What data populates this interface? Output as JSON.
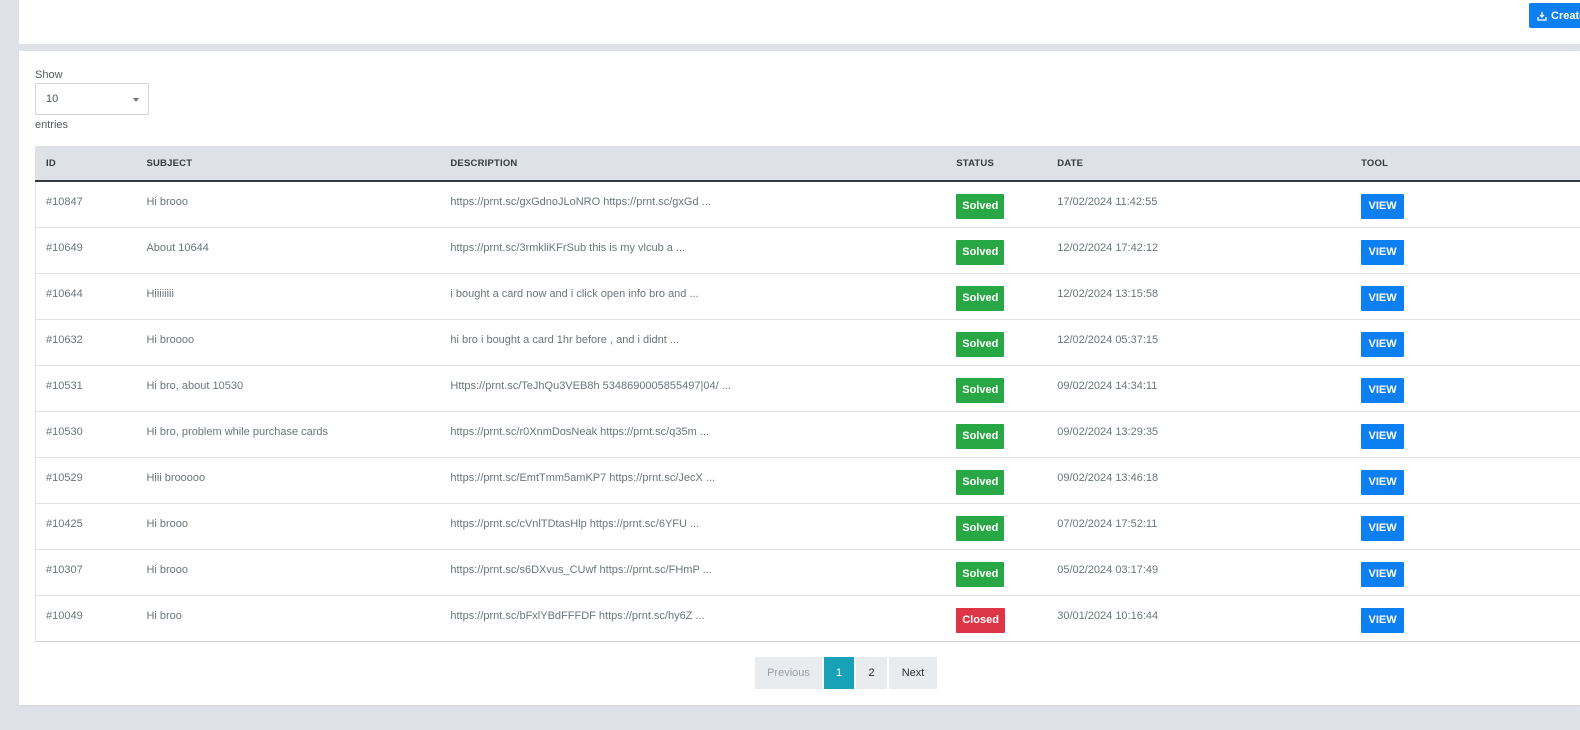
{
  "toolbar": {
    "create_label": "Create"
  },
  "length_menu": {
    "show_label": "Show",
    "value": "10",
    "entries_label": "entries"
  },
  "table": {
    "headers": [
      "ID",
      "SUBJECT",
      "DESCRIPTION",
      "STATUS",
      "DATE",
      "TOOL"
    ],
    "rows": [
      {
        "id": "#10847",
        "subject": "Hi brooo",
        "description": "https://prnt.sc/gxGdnoJLoNRO https://prnt.sc/gxGd ...",
        "status": "Solved",
        "date": "17/02/2024 11:42:55",
        "tool": "VIEW"
      },
      {
        "id": "#10649",
        "subject": "About 10644",
        "description": "https://prnt.sc/3rmkliKFrSub this is my vlcub a ...",
        "status": "Solved",
        "date": "12/02/2024 17:42:12",
        "tool": "VIEW"
      },
      {
        "id": "#10644",
        "subject": "Hiiiiiiii",
        "description": "i bought a card now and i click open info bro and ...",
        "status": "Solved",
        "date": "12/02/2024 13:15:58",
        "tool": "VIEW"
      },
      {
        "id": "#10632",
        "subject": "Hi broooo",
        "description": "hi bro i bought a card 1hr before , and i didnt ...",
        "status": "Solved",
        "date": "12/02/2024 05:37:15",
        "tool": "VIEW"
      },
      {
        "id": "#10531",
        "subject": "Hi bro, about 10530",
        "description": "Https://prnt.sc/TeJhQu3VEB8h 5348690005855497|04/ ...",
        "status": "Solved",
        "date": "09/02/2024 14:34:11",
        "tool": "VIEW"
      },
      {
        "id": "#10530",
        "subject": "Hi bro, problem while purchase cards",
        "description": "https://prnt.sc/r0XnmDosNeak https://prnt.sc/q35m ...",
        "status": "Solved",
        "date": "09/02/2024 13:29:35",
        "tool": "VIEW"
      },
      {
        "id": "#10529",
        "subject": "Hiii brooooo",
        "description": "https://prnt.sc/EmtTmm5amKP7 https://prnt.sc/JecX ...",
        "status": "Solved",
        "date": "09/02/2024 13:46:18",
        "tool": "VIEW"
      },
      {
        "id": "#10425",
        "subject": "Hi brooo",
        "description": "https://prnt.sc/cVnlTDtasHlp https://prnt.sc/6YFU ...",
        "status": "Solved",
        "date": "07/02/2024 17:52:11",
        "tool": "VIEW"
      },
      {
        "id": "#10307",
        "subject": "Hi brooo",
        "description": "https://prnt.sc/s6DXvus_CUwf https://prnt.sc/FHmP ...",
        "status": "Solved",
        "date": "05/02/2024 03:17:49",
        "tool": "VIEW"
      },
      {
        "id": "#10049",
        "subject": "Hi broo",
        "description": "https://prnt.sc/bFxlYBdFFFDF https://prnt.sc/hy6Z ...",
        "status": "Closed",
        "date": "30/01/2024 10:16:44",
        "tool": "VIEW"
      }
    ]
  },
  "pagination": {
    "previous": "Previous",
    "pages": [
      "1",
      "2"
    ],
    "active_page": "1",
    "next": "Next"
  },
  "colors": {
    "primary": "#0d7ff0",
    "solved": "#28a745",
    "closed": "#dc3545",
    "active_page": "#17a2b8"
  },
  "icons": {
    "create": "download-icon",
    "select": "caret-down-icon"
  }
}
